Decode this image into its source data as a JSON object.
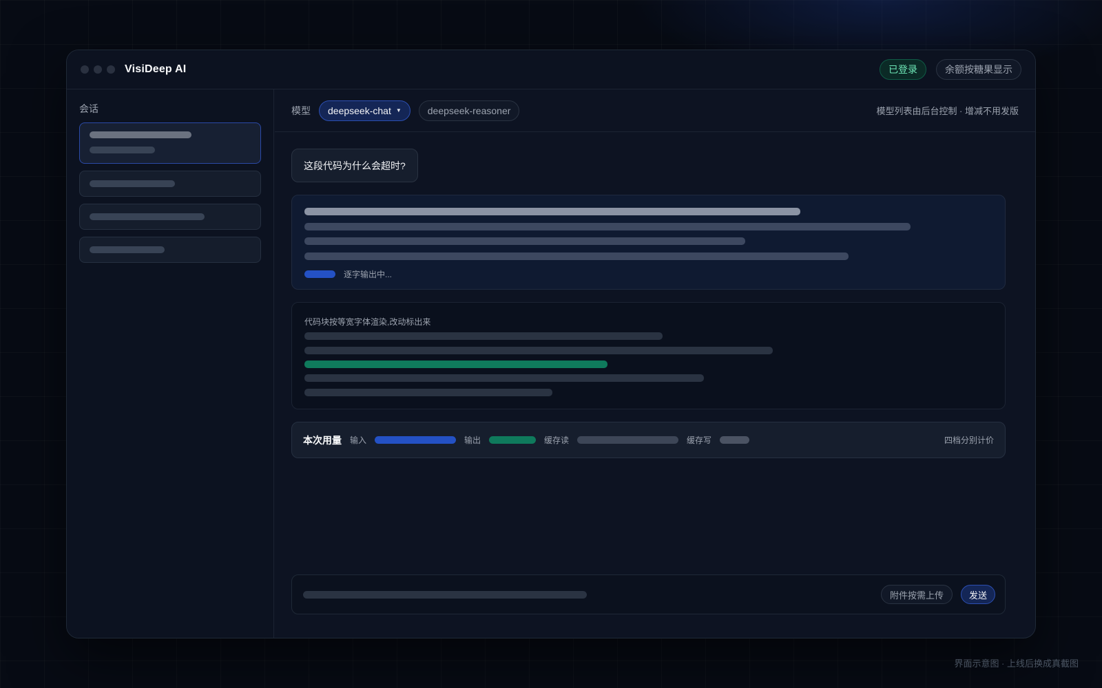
{
  "window": {
    "title": "VisiDeep AI"
  },
  "header": {
    "login_status": "已登录",
    "balance_note": "余额按糖果显示"
  },
  "sidebar": {
    "label": "会话"
  },
  "model_bar": {
    "label": "模型",
    "models": [
      {
        "name": "deepseek-chat",
        "selected": true
      },
      {
        "name": "deepseek-reasoner",
        "selected": false
      }
    ],
    "note": "模型列表由后台控制 · 增减不用发版"
  },
  "chat": {
    "user_message": "这段代码为什么会超时?",
    "streaming_status": "逐字输出中..."
  },
  "code_block": {
    "caption": "代码块按等宽字体渲染,改动标出来"
  },
  "usage": {
    "title": "本次用量",
    "input_label": "输入",
    "output_label": "输出",
    "cache_read_label": "缓存读",
    "cache_write_label": "缓存写",
    "note": "四档分别计价"
  },
  "composer": {
    "attach_label": "附件按需上传",
    "send_label": "发送"
  },
  "footer": {
    "note": "界面示意图 · 上线后换成真截图"
  },
  "colors": {
    "accent": "#2451c4",
    "success": "#0f7a5c",
    "background": "#070b14",
    "panel": "#0d1322"
  }
}
